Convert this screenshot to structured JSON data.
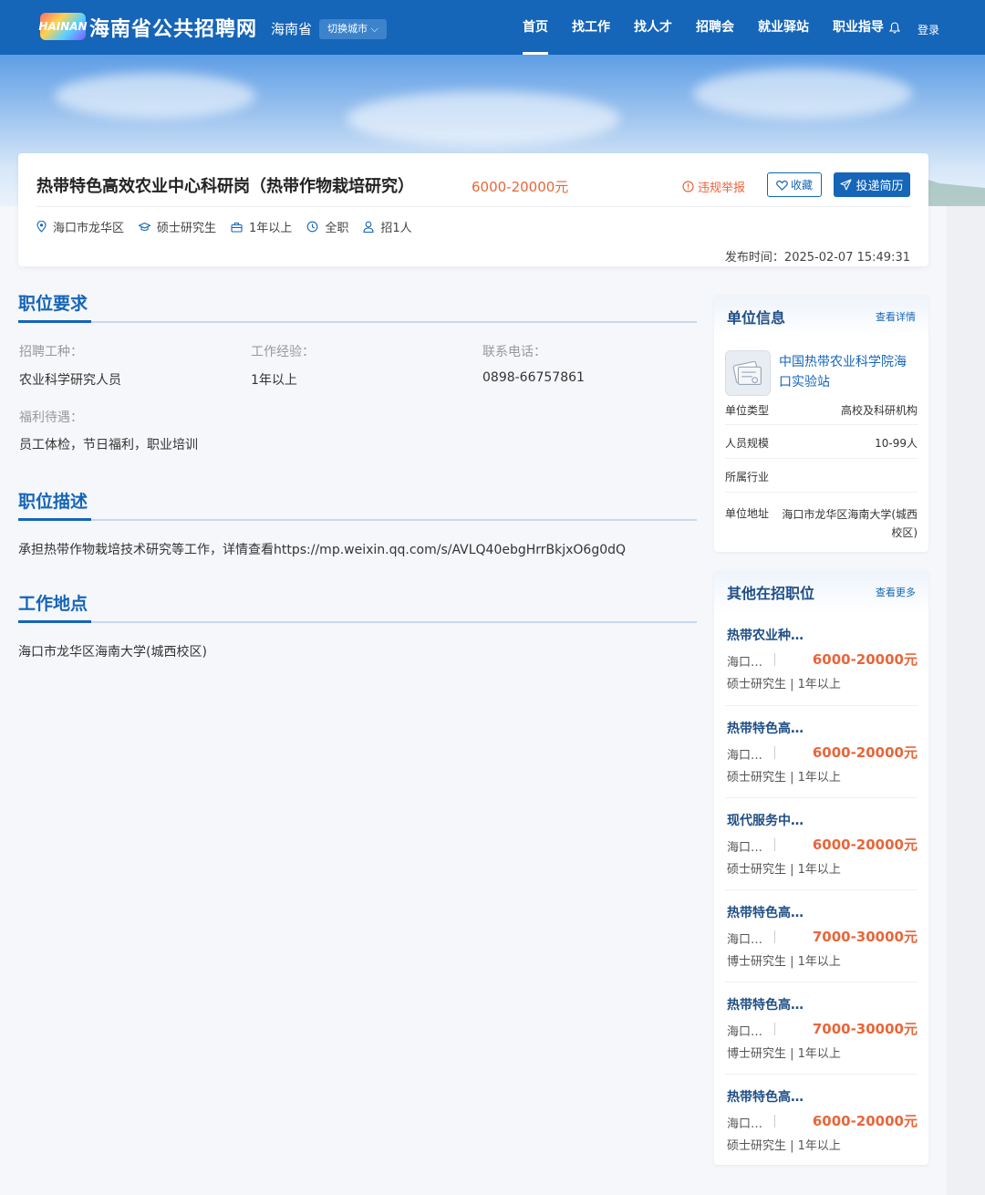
{
  "header": {
    "logo_text": "HAINAN",
    "site_title": "海南省公共招聘网",
    "province": "海南省",
    "switch_city": "切换城市 ⌵",
    "nav": [
      "首页",
      "找工作",
      "找人才",
      "招聘会",
      "就业驿站",
      "职业指导"
    ],
    "active_nav": "首页",
    "login": "登录"
  },
  "job": {
    "title": "热带特色高效农业中心科研岗（热带作物栽培研究）",
    "salary": "6000-20000元",
    "report": "违规举报",
    "favorite": "收藏",
    "apply": "投递简历",
    "meta": {
      "location": "海口市龙华区",
      "education": "硕士研究生",
      "experience": "1年以上",
      "type": "全职",
      "headcount": "招1人"
    },
    "publish_time": "发布时间：2025-02-07 15:49:31"
  },
  "requirements": {
    "title": "职位要求",
    "fields": [
      {
        "label": "招聘工种：",
        "value": "农业科学研究人员"
      },
      {
        "label": "工作经验：",
        "value": "1年以上"
      },
      {
        "label": "联系电话：",
        "value": "0898-66757861"
      },
      {
        "label": "福利待遇：",
        "value": "员工体检，节日福利，职业培训"
      }
    ]
  },
  "description": {
    "title": "职位描述",
    "text": "承担热带作物栽培技术研究等工作，详情查看https://mp.weixin.qq.com/s/AVLQ40ebgHrrBkjxO6g0dQ"
  },
  "location_section": {
    "title": "工作地点",
    "text": "海口市龙华区海南大学(城西校区)"
  },
  "company": {
    "head_title": "单位信息",
    "head_link": "查看详情",
    "name": "中国热带农业科学院海口实验站",
    "rows": [
      {
        "k": "单位类型",
        "v": "高校及科研机构"
      },
      {
        "k": "人员规模",
        "v": "10-99人"
      },
      {
        "k": "所属行业",
        "v": ""
      },
      {
        "k": "单位地址",
        "v": "海口市龙华区海南大学(城西校区)"
      }
    ]
  },
  "other_jobs": {
    "head_title": "其他在招职位",
    "head_link": "查看更多",
    "items": [
      {
        "title": "热带农业种…",
        "loc": "海口…",
        "salary": "6000-20000元",
        "req": "硕士研究生 | 1年以上"
      },
      {
        "title": "热带特色高…",
        "loc": "海口…",
        "salary": "6000-20000元",
        "req": "硕士研究生 | 1年以上"
      },
      {
        "title": "现代服务中…",
        "loc": "海口…",
        "salary": "6000-20000元",
        "req": "硕士研究生 | 1年以上"
      },
      {
        "title": "热带特色高…",
        "loc": "海口…",
        "salary": "7000-30000元",
        "req": "博士研究生 | 1年以上"
      },
      {
        "title": "热带特色高…",
        "loc": "海口…",
        "salary": "7000-30000元",
        "req": "博士研究生 | 1年以上"
      },
      {
        "title": "热带特色高…",
        "loc": "海口…",
        "salary": "6000-20000元",
        "req": "硕士研究生 | 1年以上"
      }
    ]
  },
  "colors": {
    "primary": "#1565b8",
    "accent": "#e8663a"
  }
}
